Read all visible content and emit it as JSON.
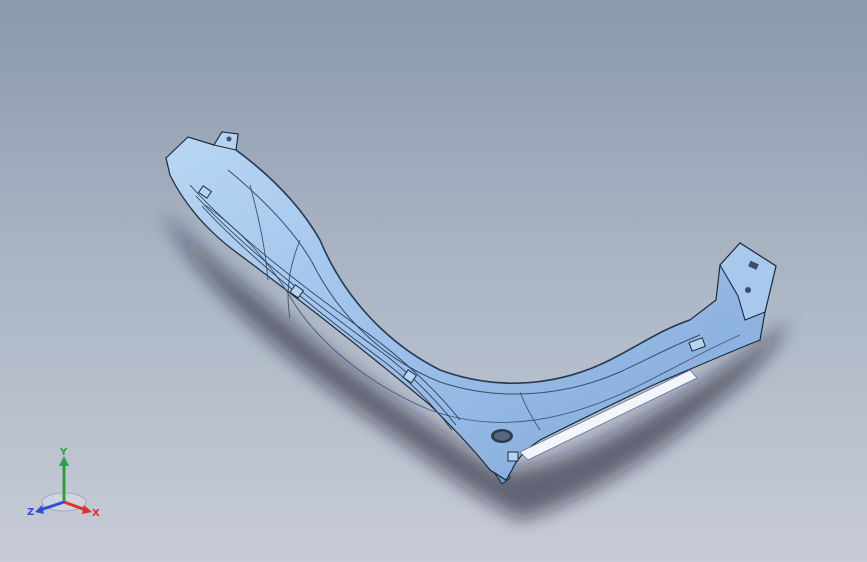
{
  "viewport": {
    "background_top": "#8a99ad",
    "background_bottom": "#c7ccd7",
    "model_color": "#9ec3ec"
  },
  "triad": {
    "y_label": "Y",
    "z_label": "Z",
    "x_label": "X",
    "y_color": "#2ea043",
    "z_color": "#2a52d8",
    "x_color": "#e03030"
  }
}
